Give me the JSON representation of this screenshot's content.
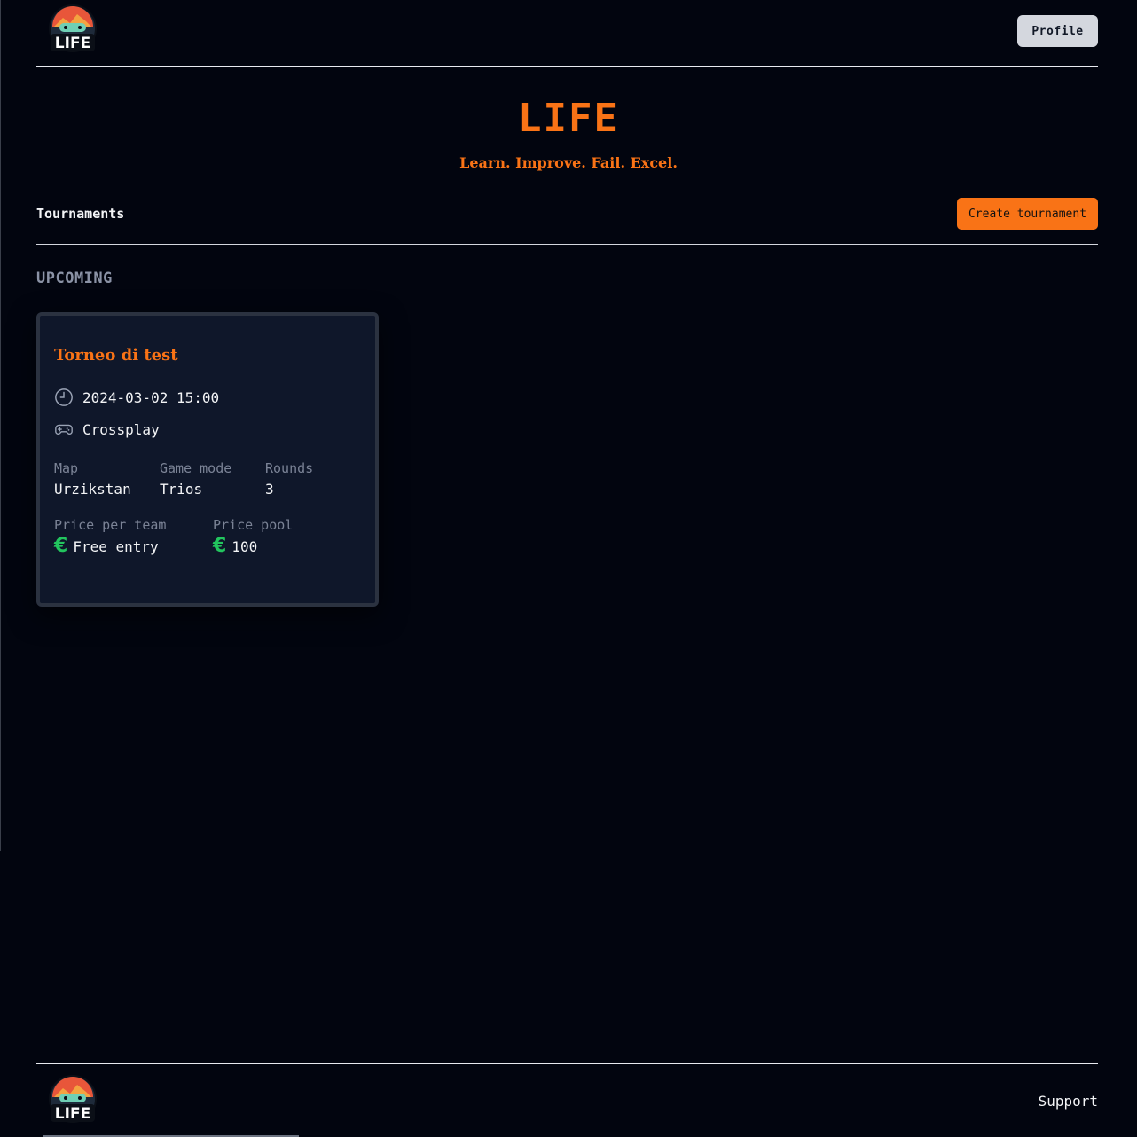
{
  "header": {
    "logo_text": "LIFE",
    "profile_label": "Profile"
  },
  "hero": {
    "title": "LIFE",
    "subtitle": "Learn. Improve. Fail. Excel."
  },
  "section": {
    "title": "Tournaments",
    "create_label": "Create tournament",
    "upcoming_label": "UPCOMING"
  },
  "tournament": {
    "name": "Torneo di test",
    "datetime": "2024-03-02 15:00",
    "platform": "Crossplay",
    "map_label": "Map",
    "map_value": "Urzikstan",
    "mode_label": "Game mode",
    "mode_value": "Trios",
    "rounds_label": "Rounds",
    "rounds_value": "3",
    "price_team_label": "Price per team",
    "price_team_value": "Free entry",
    "price_pool_label": "Price pool",
    "price_pool_value": "100",
    "currency_symbol": "€",
    "icons": [
      "clock-icon",
      "gamepad-icon",
      "euro-icon"
    ]
  },
  "footer": {
    "logo_text": "LIFE",
    "support_label": "Support"
  },
  "colors": {
    "background": "#02050f",
    "accent": "#f97316",
    "card": "#0f172a",
    "money": "#22c55e"
  }
}
